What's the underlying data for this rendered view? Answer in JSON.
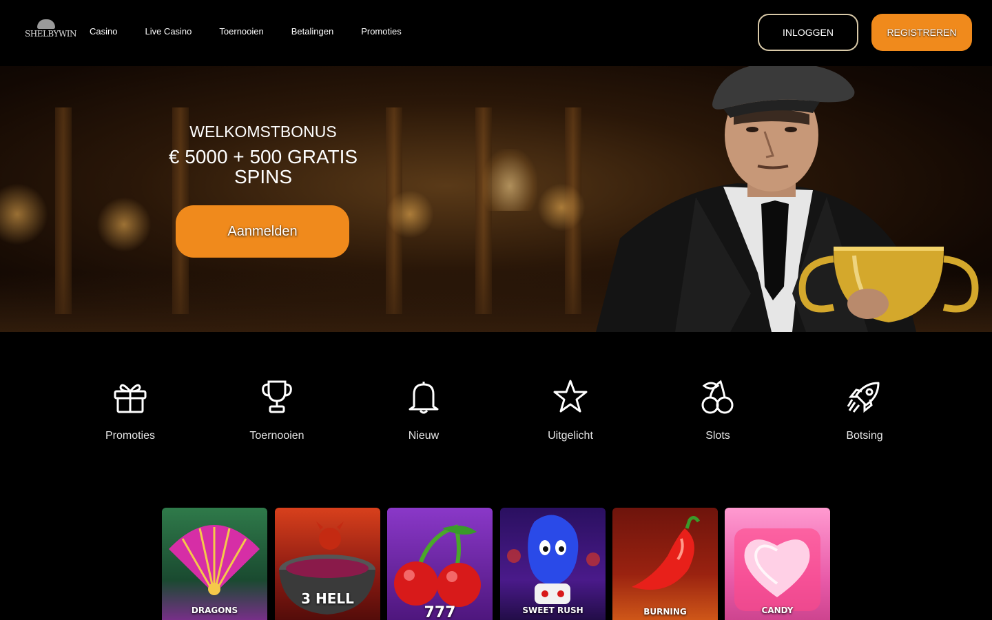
{
  "header": {
    "logo_text": "SHELBYWIN",
    "nav": [
      "Casino",
      "Live Casino",
      "Toernooien",
      "Betalingen",
      "Promoties"
    ],
    "login_label": "INLOGGEN",
    "register_label": "REGISTREREN"
  },
  "hero": {
    "kicker": "WELKOMSTBONUS",
    "title": "€ 5000 + 500 GRATIS SPINS",
    "cta_label": "Aanmelden"
  },
  "categories": [
    {
      "label": "Promoties",
      "icon": "gift-icon"
    },
    {
      "label": "Toernooien",
      "icon": "trophy-icon"
    },
    {
      "label": "Nieuw",
      "icon": "bell-icon"
    },
    {
      "label": "Uitgelicht",
      "icon": "star-icon"
    },
    {
      "label": "Slots",
      "icon": "cherries-icon"
    },
    {
      "label": "Botsing",
      "icon": "rocket-icon"
    }
  ],
  "games": [
    {
      "title": "DRAGONS",
      "bg": "#2f7a4a"
    },
    {
      "title": "3 HELL",
      "bg": "#b3231a"
    },
    {
      "title": "777",
      "bg": "#6a1f9e"
    },
    {
      "title": "SWEET RUSH",
      "bg": "#3a1670"
    },
    {
      "title": "BURNING",
      "bg": "#6e140c"
    },
    {
      "title": "CANDY",
      "bg": "#e85aa8"
    }
  ],
  "colors": {
    "accent": "#f08a1c",
    "login_border": "#d8c9a8"
  }
}
